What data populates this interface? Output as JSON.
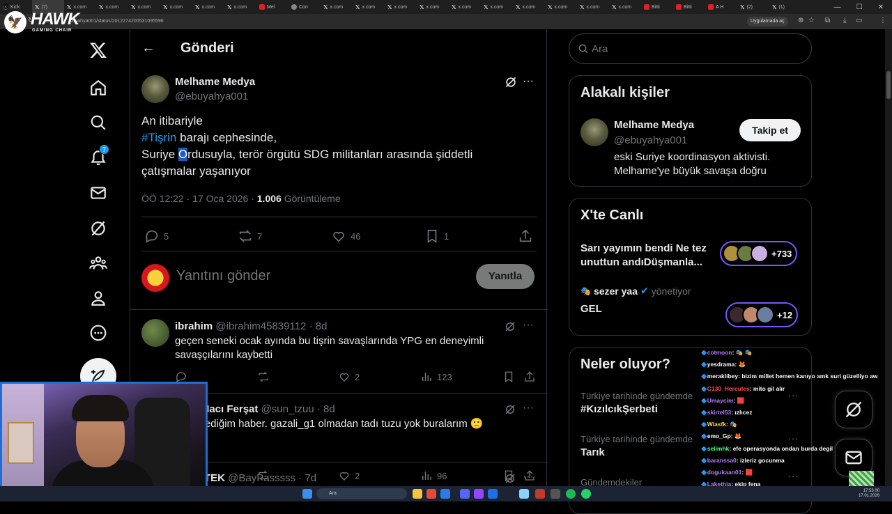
{
  "browser": {
    "tabs": [
      {
        "icon": "kick",
        "label": "Kick"
      },
      {
        "icon": "x",
        "label": "(7)"
      },
      {
        "icon": "x",
        "label": "x.com"
      },
      {
        "icon": "x",
        "label": "x.com"
      },
      {
        "icon": "x",
        "label": "x.com"
      },
      {
        "icon": "x",
        "label": "x.com"
      },
      {
        "icon": "x",
        "label": "x.com"
      },
      {
        "icon": "x",
        "label": "x.com"
      },
      {
        "icon": "youtube",
        "label": "Mel"
      },
      {
        "icon": "globe",
        "label": "Con"
      },
      {
        "icon": "x",
        "label": "x.com"
      },
      {
        "icon": "x",
        "label": "x.com"
      },
      {
        "icon": "x",
        "label": "x.com"
      },
      {
        "icon": "x",
        "label": "x.com"
      },
      {
        "icon": "x",
        "label": "x.com"
      },
      {
        "icon": "x",
        "label": "x.com"
      },
      {
        "icon": "x",
        "label": "x.com"
      },
      {
        "icon": "x",
        "label": "x.com"
      },
      {
        "icon": "x",
        "label": "x.com"
      },
      {
        "icon": "x",
        "label": "x.com"
      },
      {
        "icon": "youtube",
        "label": "Bitti"
      },
      {
        "icon": "youtube",
        "label": "Bitti"
      },
      {
        "icon": "youtube",
        "label": "A H"
      },
      {
        "icon": "x",
        "label": "(2)"
      },
      {
        "icon": "x",
        "label": "(1)"
      }
    ],
    "url": "buyahya001/status/2012274200531095596",
    "open_in_app": "Uygulamada aç"
  },
  "stream_logo": {
    "brand": "HAWK",
    "sub": "GAMING CHAIR"
  },
  "nav": {
    "notifications_badge": "7"
  },
  "header": {
    "title": "Gönderi"
  },
  "post": {
    "author_name": "Melhame Medya",
    "author_handle": "@ebuyahya001",
    "line1": "An itibariyle",
    "hashtag": "#Tişrin",
    "line2_rest": " barajı cephesinde,",
    "line3_a": "Suriye ",
    "line3_sel": "O",
    "line3_b": "rdusuyla, terör örgütü SDG militanları arasında şiddetli",
    "line4": "çatışmalar yaşanıyor",
    "time": "ÖÖ 12:22 · 17 Oca 2026 ·",
    "views": "1.006",
    "views_label": "Görüntüleme",
    "replies": "5",
    "reposts": "7",
    "likes": "46",
    "bookmarks": "1"
  },
  "reply_box": {
    "placeholder": "Yanıtını gönder",
    "button": "Yanıtla"
  },
  "replies": [
    {
      "name": "ibrahim",
      "handle": "@ibrahim45839112",
      "age": "· 8d",
      "text": "geçen seneki ocak ayında bu tişrin savaşlarında YPG en deneyimli savaşçılarını kaybetti",
      "replies": "",
      "reposts": "",
      "likes": "2",
      "views": "123"
    },
    {
      "name": "a Hacı Ferşat",
      "handle": "@sun_tzuu",
      "age": "· 8d",
      "text": "kledi​ğim haber. gazali_g1 olmadan tadı tuzu yok buralarım 🙁",
      "replies": "",
      "reposts": "",
      "likes": "2",
      "views": "96"
    },
    {
      "name": "TEK",
      "handle": "@BayPasssss",
      "age": "· 7d",
      "text": ""
    }
  ],
  "right": {
    "search_placeholder": "Ara",
    "relevant": {
      "title": "Alakalı kişiler",
      "name": "Melhame Medya",
      "handle": "@ebuyahya001",
      "follow": "Takip et",
      "bio1": "eski Suriye koordinasyon aktivisti.",
      "bio2": "Melhame'ye büyük savaşa doğru"
    },
    "live": {
      "title": "X'te Canlı",
      "s1_title": "Sarı yayımın bendi Ne tez unuttun andıDüşmanla...",
      "s1_count": "+733",
      "s2_host": "sezer yaa",
      "s2_role": "yönetiyor",
      "s2_title": "GEL",
      "s2_count": "+12"
    },
    "trends": {
      "title": "Neler oluyor?",
      "items": [
        {
          "context": "Türkiye tarihinde gündemde",
          "name": "#KızılcıkŞerbeti"
        },
        {
          "context": "Türkiye tarihinde gündemde",
          "name": "Tarık"
        },
        {
          "context": "Gündemdekiler",
          "name": ""
        }
      ]
    }
  },
  "chat": [
    {
      "user": "cotmoon",
      "color": "#b77dff",
      "msg": ": 🎭 🎭"
    },
    {
      "user": "yesdrama",
      "color": "#ffffff",
      "msg": ": 🦊"
    },
    {
      "user": "meraklibey",
      "color": "#ffffff",
      "msg": ": bizim millet hemen kanıyo amk suri güzelliyo aw"
    },
    {
      "user": "C130_Hercules",
      "color": "#ff4d4d",
      "msg": ": mito gil alır"
    },
    {
      "user": "Umaycim",
      "color": "#b77dff",
      "msg": ": 🟥"
    },
    {
      "user": "skirtel53",
      "color": "#b77dff",
      "msg": ": ızlıcez"
    },
    {
      "user": "Wiasfk",
      "color": "#ffd84d",
      "msg": ": 🎭"
    },
    {
      "user": "emo_Gp",
      "color": "#ffffff",
      "msg": ": 🦊"
    },
    {
      "user": "selimhk",
      "color": "#4dff88",
      "msg": ": efe operasyonda ondan burda degil"
    },
    {
      "user": "baranssa0",
      "color": "#b77dff",
      "msg": ": izleriz gocunma"
    },
    {
      "user": "dogukaan01",
      "color": "#b77dff",
      "msg": ": 🟥"
    },
    {
      "user": "Lakethia",
      "color": "#b77dff",
      "msg": ": ekip fena"
    }
  ],
  "taskbar": {
    "search": "Ara",
    "time": "17:53 00",
    "date": "17.01.2026"
  },
  "colors": {
    "accent": "#1d9bf0",
    "live_border": "#7856ff",
    "bg": "#000000",
    "border": "#2f3336"
  }
}
